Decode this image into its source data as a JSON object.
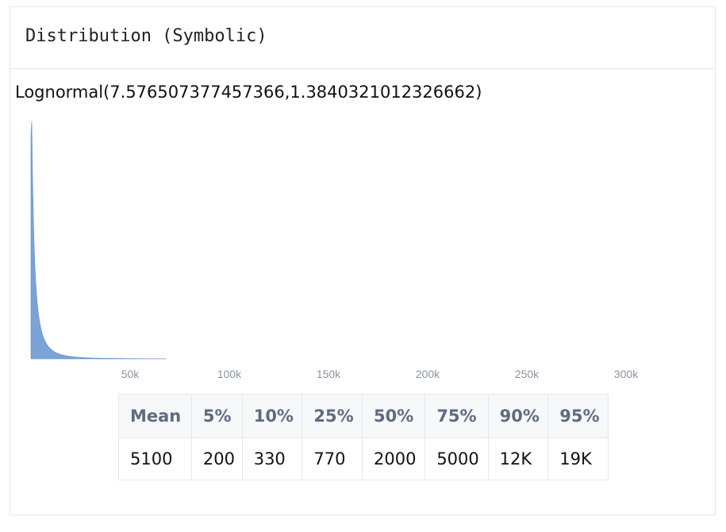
{
  "panel": {
    "title": "Distribution (Symbolic)",
    "expression": "Lognormal(7.576507377457366,1.3840321012326662)"
  },
  "colors": {
    "fill": "#7ba3d6",
    "stroke": "#5c8dcc"
  },
  "chart_data": {
    "type": "area",
    "distribution": "lognormal",
    "mu": 7.576507377457366,
    "sigma": 1.3840321012326662,
    "xlim": [
      0,
      300000
    ],
    "x_ticks": [
      {
        "value": 50000,
        "label": "50k"
      },
      {
        "value": 100000,
        "label": "100k"
      },
      {
        "value": 150000,
        "label": "150k"
      },
      {
        "value": 200000,
        "label": "200k"
      },
      {
        "value": 250000,
        "label": "250k"
      },
      {
        "value": 300000,
        "label": "300k"
      }
    ],
    "x_data_max": 68000,
    "grid": false,
    "legend": "none"
  },
  "stats": {
    "headers": [
      "Mean",
      "5%",
      "10%",
      "25%",
      "50%",
      "75%",
      "90%",
      "95%"
    ],
    "values": [
      "5100",
      "200",
      "330",
      "770",
      "2000",
      "5000",
      "12K",
      "19K"
    ]
  }
}
